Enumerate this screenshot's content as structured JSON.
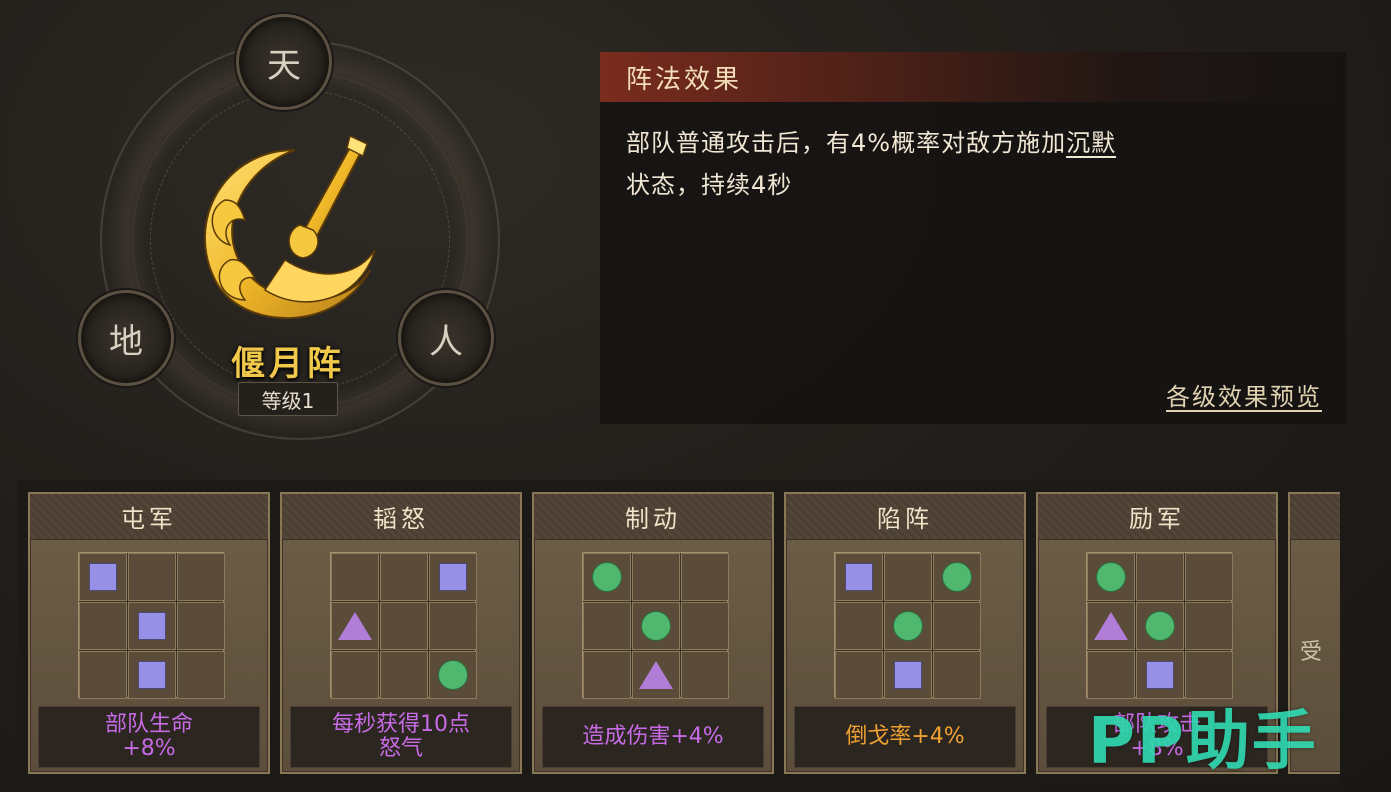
{
  "formation": {
    "name": "偃月阵",
    "level": "等级1",
    "nodes": {
      "top": "天",
      "left": "地",
      "right": "人"
    }
  },
  "effect": {
    "header": "阵法效果",
    "text_before": "部队普通攻击后，有4%概率对敌方施加",
    "text_link": "沉默",
    "text_after": "状态，持续4秒",
    "preview_link": "各级效果预览"
  },
  "cards": [
    {
      "title": "屯军",
      "grid": [
        "square",
        "",
        "",
        "",
        "square",
        "",
        "",
        "square",
        ""
      ],
      "bonus": "部队生命\n+8%",
      "bonus_color": "#c76ae6"
    },
    {
      "title": "韬怒",
      "grid": [
        "",
        "",
        "square",
        "triangle",
        "",
        "",
        "",
        "",
        "circle"
      ],
      "bonus": "每秒获得10点\n怒气",
      "bonus_color": "#c76ae6"
    },
    {
      "title": "制动",
      "grid": [
        "circle",
        "",
        "",
        "",
        "circle",
        "",
        "",
        "triangle",
        ""
      ],
      "bonus": "造成伤害+4%",
      "bonus_color": "#c76ae6"
    },
    {
      "title": "陷阵",
      "grid": [
        "square",
        "",
        "circle",
        "",
        "circle",
        "",
        "",
        "square",
        ""
      ],
      "bonus": "倒戈率+4%",
      "bonus_color": "#f0a030"
    },
    {
      "title": "励军",
      "grid": [
        "circle",
        "",
        "",
        "triangle",
        "circle",
        "",
        "",
        "square",
        ""
      ],
      "bonus": "部队攻击\n+8%",
      "bonus_color": "#c76ae6"
    }
  ],
  "partial_card": {
    "text": "受"
  },
  "watermark": "PP助手",
  "colors": {
    "accent_gold": "#f0c84a",
    "header_red": "#7a2c1e",
    "square": "#9690e6",
    "circle": "#4fb86e",
    "triangle": "#b07ed6"
  }
}
